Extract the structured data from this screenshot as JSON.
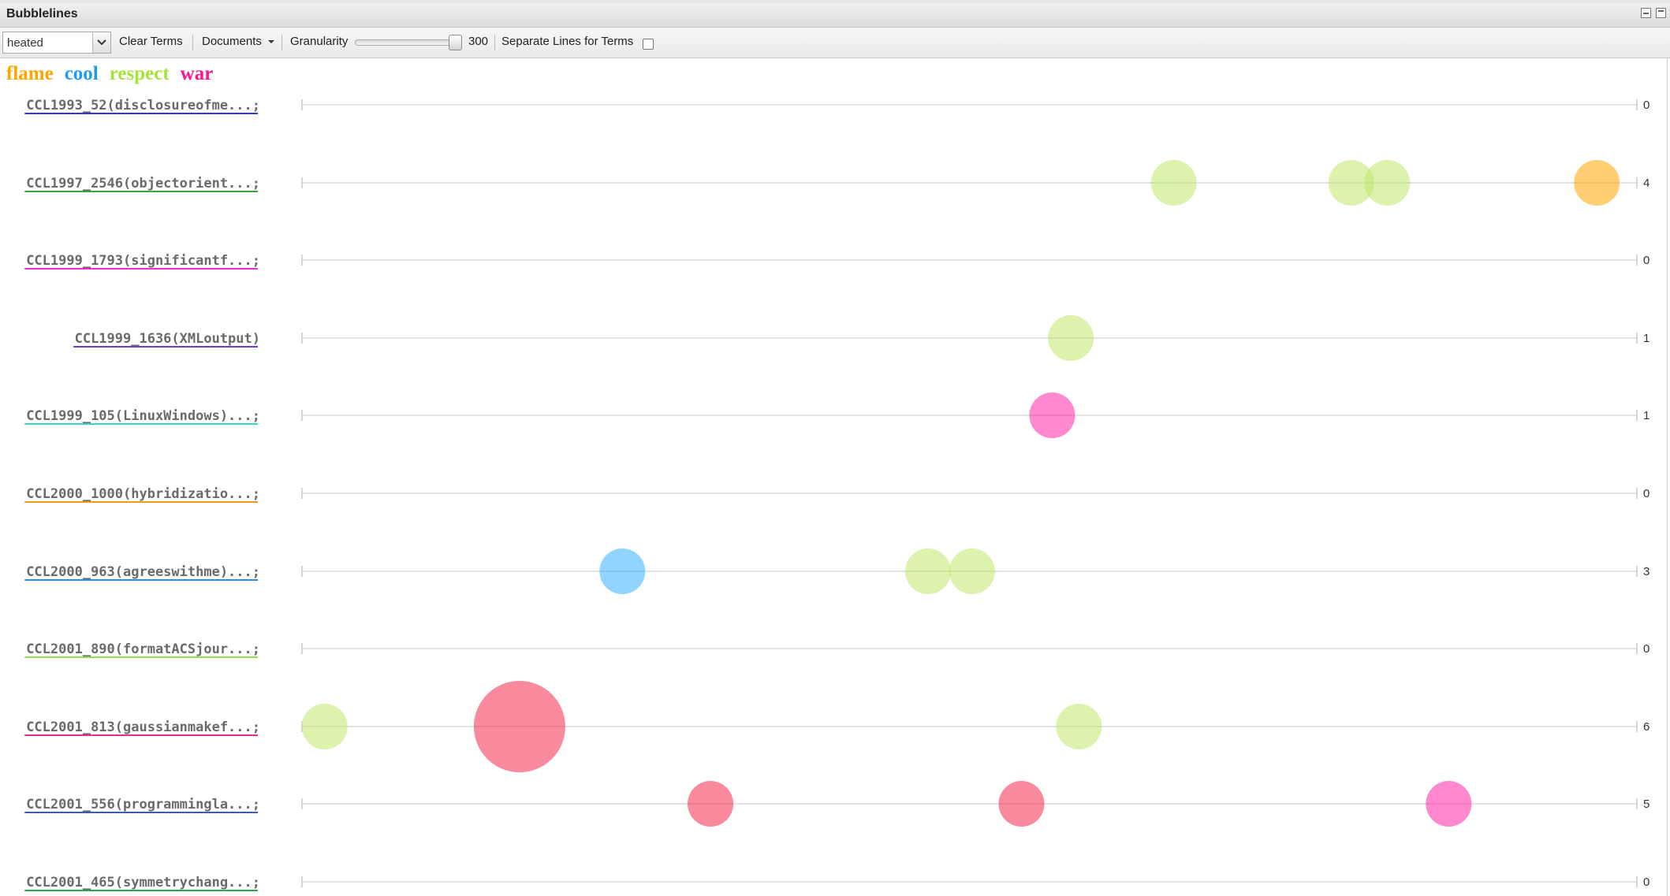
{
  "window": {
    "title": "Bubblelines"
  },
  "toolbar": {
    "search_value": "heated",
    "clear_terms_label": "Clear Terms",
    "documents_label": "Documents",
    "granularity_label": "Granularity",
    "granularity_value": "300",
    "granularity_fraction": 1.0,
    "separate_lines_label": "Separate Lines for Terms",
    "separate_lines_checked": false
  },
  "legend": {
    "terms": [
      {
        "label": "flame",
        "color": "#ffa500"
      },
      {
        "label": "cool",
        "color": "#1e9be9"
      },
      {
        "label": "respect",
        "color": "#a8e33a"
      },
      {
        "label": "war",
        "color": "#ff1493"
      }
    ]
  },
  "chart_data": {
    "type": "scatter",
    "granularity": 300,
    "term_colors": {
      "flame": "#ffa500",
      "cool": "#33b3ff",
      "respect": "#bfe86a",
      "war": "#ff26a8",
      "heated": "#f4284a"
    },
    "documents": [
      {
        "label": "CCL1993_52(disclosureofme...;",
        "underline": "#2a3bd6",
        "count": "0",
        "bubbles": []
      },
      {
        "label": "CCL1997_2546(objectorient...;",
        "underline": "#3aa53a",
        "count": "4",
        "bubbles": [
          {
            "term": "respect",
            "pos": 0.653,
            "size": 1
          },
          {
            "term": "respect",
            "pos": 0.786,
            "size": 1
          },
          {
            "term": "respect",
            "pos": 0.813,
            "size": 1
          },
          {
            "term": "flame",
            "pos": 0.97,
            "size": 1
          }
        ]
      },
      {
        "label": "CCL1999_1793(significantf...;",
        "underline": "#e22ed2",
        "count": "0",
        "bubbles": []
      },
      {
        "label": "CCL1999_1636(XMLoutput)",
        "underline": "#7a3cc8",
        "count": "1",
        "bubbles": [
          {
            "term": "respect",
            "pos": 0.576,
            "size": 1
          }
        ]
      },
      {
        "label": "CCL1999_105(LinuxWindows)...;",
        "underline": "#2ed6d6",
        "count": "1",
        "bubbles": [
          {
            "term": "war",
            "pos": 0.562,
            "size": 1
          }
        ]
      },
      {
        "label": "CCL2000_1000(hybridizatio...;",
        "underline": "#f29a1e",
        "count": "0",
        "bubbles": []
      },
      {
        "label": "CCL2000_963(agreeswithme)...;",
        "underline": "#2f8de0",
        "count": "3",
        "bubbles": [
          {
            "term": "cool",
            "pos": 0.24,
            "size": 1
          },
          {
            "term": "respect",
            "pos": 0.469,
            "size": 1
          },
          {
            "term": "respect",
            "pos": 0.502,
            "size": 1
          }
        ]
      },
      {
        "label": "CCL2001_890(formatACSjour...;",
        "underline": "#8fe04a",
        "count": "0",
        "bubbles": []
      },
      {
        "label": "CCL2001_813(gaussianmakef...;",
        "underline": "#e0308e",
        "count": "6",
        "bubbles": [
          {
            "term": "respect",
            "pos": 0.017,
            "size": 1
          },
          {
            "term": "heated",
            "pos": 0.163,
            "size": 4
          },
          {
            "term": "respect",
            "pos": 0.582,
            "size": 1
          }
        ]
      },
      {
        "label": "CCL2001_556(programmingla...;",
        "underline": "#3b5bb5",
        "count": "5",
        "bubbles": [
          {
            "term": "heated",
            "pos": 0.306,
            "size": 1
          },
          {
            "term": "heated",
            "pos": 0.539,
            "size": 1
          },
          {
            "term": "war",
            "pos": 0.859,
            "size": 1
          }
        ]
      },
      {
        "label": "CCL2001_465(symmetrychang...;",
        "underline": "#2aa84a",
        "count": "0",
        "bubbles": []
      }
    ]
  }
}
